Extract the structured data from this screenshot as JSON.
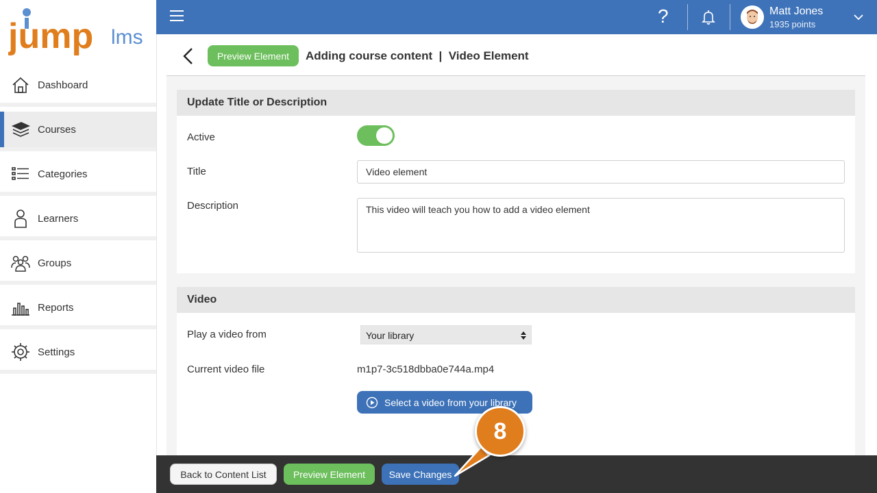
{
  "brand": {
    "logo_main": "jump",
    "logo_suffix": "lms",
    "accent": "#e07d1c",
    "topbar": "#3f73b9"
  },
  "sidebar": {
    "items": [
      {
        "label": "Dashboard",
        "icon": "home-icon",
        "active": false
      },
      {
        "label": "Courses",
        "icon": "books-icon",
        "active": true
      },
      {
        "label": "Categories",
        "icon": "list-icon",
        "active": false
      },
      {
        "label": "Learners",
        "icon": "person-icon",
        "active": false
      },
      {
        "label": "Groups",
        "icon": "group-icon",
        "active": false
      },
      {
        "label": "Reports",
        "icon": "bar-chart-icon",
        "active": false
      },
      {
        "label": "Settings",
        "icon": "gear-icon",
        "active": false
      }
    ]
  },
  "topbar": {
    "help_symbol": "?",
    "user": {
      "name": "Matt Jones",
      "points": "1935 points"
    }
  },
  "header": {
    "preview_label": "Preview Element",
    "title": "Adding course content  |  Video Element"
  },
  "details_card": {
    "heading": "Update Title or Description",
    "active_label": "Active",
    "active_value": true,
    "title_label": "Title",
    "title_value": "Video element",
    "description_label": "Description",
    "description_value": "This video will teach you how to add a video element"
  },
  "video_card": {
    "heading": "Video",
    "source_label": "Play a video from",
    "source_value": "Your library",
    "current_file_label": "Current video file",
    "current_file_value": "m1p7-3c518dbba0e744a.mp4",
    "select_button_label": "Select a video from your library"
  },
  "footer": {
    "back_label": "Back to Content List",
    "preview_label": "Preview Element",
    "save_label": "Save Changes"
  },
  "callout": {
    "step": "8"
  }
}
